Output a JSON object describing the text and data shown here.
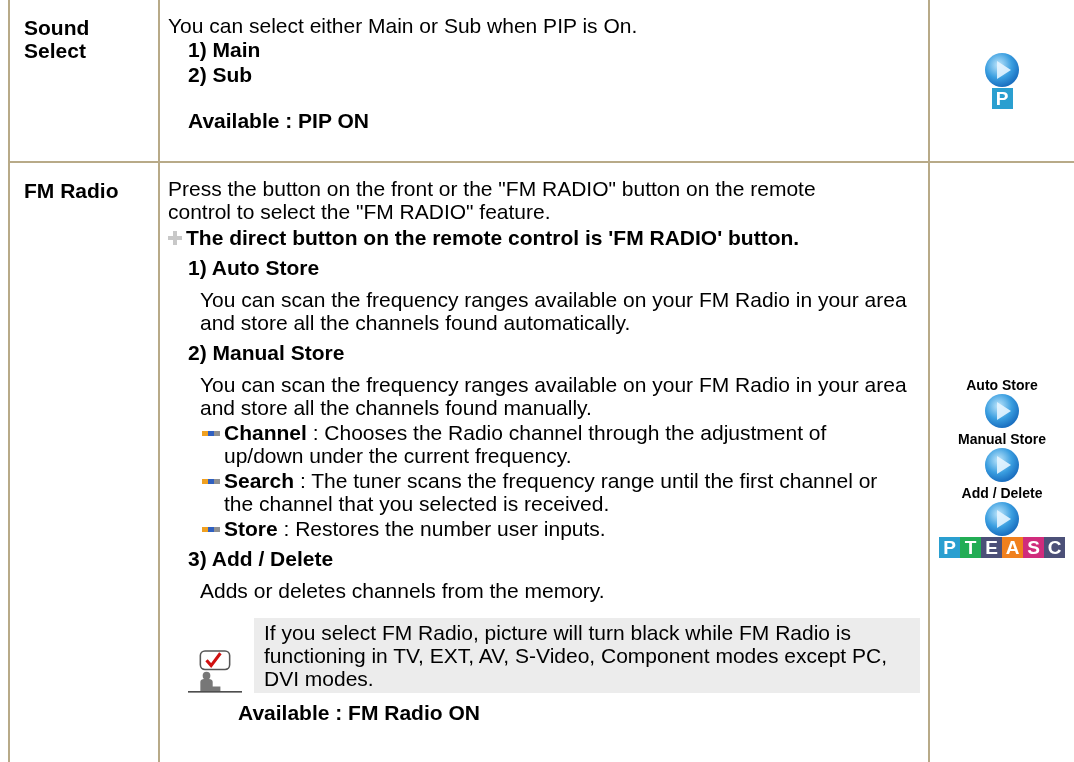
{
  "rows": [
    {
      "label": "Sound Select",
      "description": "You can select either Main or Sub when PIP is On.",
      "options": [
        "1) Main",
        "2) Sub"
      ],
      "available": "Available : PIP ON",
      "side": {
        "buttons": [
          {
            "kind": "plain"
          }
        ],
        "badges": [
          {
            "letter": "P",
            "color": "#2a9fd0"
          }
        ]
      }
    },
    {
      "label": "FM Radio",
      "description": "Press the button on the front or the \"FM RADIO\" button on the remote control to select the \"FM RADIO\" feature.",
      "note": "The direct button on the remote control is 'FM RADIO' button.",
      "sections": [
        {
          "heading": "1) Auto Store",
          "text": "You can scan the frequency ranges available on your FM Radio in your area and store all the channels found automatically."
        },
        {
          "heading": "2) Manual Store",
          "text": "You can scan the frequency ranges available on your FM Radio in your area and store all the channels found manually.",
          "subitems": [
            "**Channel** : Chooses the Radio channel through the adjustment of up/down under the current frequency.",
            "**Search** : The tuner scans the frequency range until the first channel or the channel that you selected is received.",
            "**Store** : Restores the number user inputs."
          ]
        },
        {
          "heading": "3) Add / Delete",
          "text": "Adds or deletes channels from the memory."
        }
      ],
      "tip": "If you select FM Radio, picture will turn black while FM Radio is functioning in TV, EXT, AV, S-Video, Component modes except PC, DVI modes.",
      "available": "Available : FM Radio ON",
      "side": {
        "buttons": [
          {
            "kind": "captioned",
            "caption": "Auto Store"
          },
          {
            "kind": "captioned",
            "caption": "Manual Store"
          },
          {
            "kind": "captioned",
            "caption": "Add / Delete"
          }
        ],
        "badges": [
          {
            "letter": "P",
            "color": "#2a9fd0"
          },
          {
            "letter": "T",
            "color": "#22ad55"
          },
          {
            "letter": "E",
            "color": "#4c5078"
          },
          {
            "letter": "A",
            "color": "#f0801e"
          },
          {
            "letter": "S",
            "color": "#d02c7c"
          },
          {
            "letter": "C",
            "color": "#4c5078"
          }
        ]
      }
    }
  ]
}
